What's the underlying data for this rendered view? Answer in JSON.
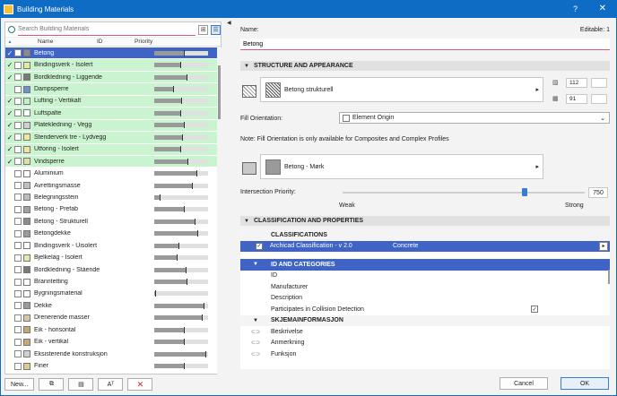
{
  "window": {
    "title": "Building Materials",
    "help_label": "?",
    "close_label": "✕"
  },
  "left": {
    "search_placeholder": "Search Building Materials",
    "columns": {
      "name": "Name",
      "id": "ID",
      "priority": "Priority",
      "sort": "▲"
    },
    "items": [
      {
        "name": "Betong",
        "checked": true,
        "green": false,
        "selected": true,
        "color": "#8c8c8c",
        "priority": 55
      },
      {
        "name": "Bindingsverk - Isolert",
        "checked": true,
        "green": true,
        "selected": false,
        "color": "#e8e8a0",
        "priority": 48
      },
      {
        "name": "Bordkledning - Liggende",
        "checked": true,
        "green": true,
        "selected": false,
        "color": "#7a7a7a",
        "priority": 60
      },
      {
        "name": "Dampsperre",
        "checked": false,
        "green": true,
        "selected": false,
        "color": "#6f8fd8",
        "priority": 35
      },
      {
        "name": "Lufting - Vertikalt",
        "checked": true,
        "green": true,
        "selected": false,
        "color": "#c8f0c8",
        "priority": 50
      },
      {
        "name": "Luftspalte",
        "checked": true,
        "green": true,
        "selected": false,
        "color": "#ffffff",
        "priority": 48
      },
      {
        "name": "Platekledning - Vegg",
        "checked": true,
        "green": true,
        "selected": false,
        "color": "#d0d0d0",
        "priority": 55
      },
      {
        "name": "Stenderverk tre - Lydvegg",
        "checked": true,
        "green": true,
        "selected": false,
        "color": "#f0e6a0",
        "priority": 52
      },
      {
        "name": "Utforing - Isolert",
        "checked": true,
        "green": true,
        "selected": false,
        "color": "#f0e6a0",
        "priority": 48
      },
      {
        "name": "Vindsperre",
        "checked": true,
        "green": true,
        "selected": false,
        "color": "#e0e0a0",
        "priority": 62
      },
      {
        "name": "Aluminium",
        "checked": false,
        "green": false,
        "selected": false,
        "color": "#ffffff",
        "priority": 78
      },
      {
        "name": "Avrettingsmasse",
        "checked": false,
        "green": false,
        "selected": false,
        "color": "#c0c0c0",
        "priority": 70
      },
      {
        "name": "Belegningsstein",
        "checked": false,
        "green": false,
        "selected": false,
        "color": "#bdbdbd",
        "priority": 10
      },
      {
        "name": "Betong - Prefab",
        "checked": false,
        "green": false,
        "selected": false,
        "color": "#a0a0a0",
        "priority": 55
      },
      {
        "name": "Betong - Strukturell",
        "checked": false,
        "green": false,
        "selected": false,
        "color": "#8c8c8c",
        "priority": 75
      },
      {
        "name": "Betongdekke",
        "checked": false,
        "green": false,
        "selected": false,
        "color": "#9a9a9a",
        "priority": 80
      },
      {
        "name": "Bindingsverk - Uisolert",
        "checked": false,
        "green": false,
        "selected": false,
        "color": "#ffffff",
        "priority": 45
      },
      {
        "name": "Bjelkelag - Isolert",
        "checked": false,
        "green": false,
        "selected": false,
        "color": "#e8e8a0",
        "priority": 42
      },
      {
        "name": "Bordkledning - Stående",
        "checked": false,
        "green": false,
        "selected": false,
        "color": "#7a7a7a",
        "priority": 58
      },
      {
        "name": "Branntetting",
        "checked": false,
        "green": false,
        "selected": false,
        "color": "#ffffff",
        "priority": 60
      },
      {
        "name": "Bygningsmaterial",
        "checked": false,
        "green": false,
        "selected": false,
        "color": "#ffffff",
        "priority": 2
      },
      {
        "name": "Dekke",
        "checked": false,
        "green": false,
        "selected": false,
        "color": "#9a9a9a",
        "priority": 92
      },
      {
        "name": "Drenerende masser",
        "checked": false,
        "green": false,
        "selected": false,
        "color": "#d8c8a8",
        "priority": 88
      },
      {
        "name": "Eik - horisontal",
        "checked": false,
        "green": false,
        "selected": false,
        "color": "#c8a870",
        "priority": 55
      },
      {
        "name": "Eik - vertikal",
        "checked": false,
        "green": false,
        "selected": false,
        "color": "#c8a870",
        "priority": 55
      },
      {
        "name": "Eksisterende konstruksjon",
        "checked": false,
        "green": false,
        "selected": false,
        "color": "#d0d0d0",
        "priority": 95
      },
      {
        "name": "Finer",
        "checked": false,
        "green": false,
        "selected": false,
        "color": "#e0c890",
        "priority": 55
      }
    ],
    "buttons": {
      "new": "New...",
      "rename_icon": "Aᵀ",
      "delete_icon": "✕"
    }
  },
  "right": {
    "name_label": "Name:",
    "editable": "Editable: 1",
    "name_value": "Betong",
    "structure": {
      "title": "STRUCTURE AND APPEARANCE",
      "cut_fill": "Betong strukturell",
      "pen1": "112",
      "pen2": "91",
      "fill_orientation_label": "Fill Orientation:",
      "fill_orientation_value": "Element Origin",
      "note": "Note: Fill Orientation is only available for Composites and Complex Profiles",
      "surface": "Betong - Mørk",
      "intersection_label": "Intersection Priority:",
      "intersection_value": "750",
      "intersection_fraction": 0.75,
      "weak": "Weak",
      "strong": "Strong"
    },
    "classification": {
      "title": "CLASSIFICATION AND PROPERTIES",
      "classifications_header": "CLASSIFICATIONS",
      "class_row_name": "Archicad Classification - v 2.0",
      "class_row_value": "Concrete",
      "id_categories_header": "ID AND CATEGORIES",
      "id_rows": [
        "ID",
        "Manufacturer",
        "Description",
        "Participates in Collision Detection"
      ],
      "collision_checked": "✓",
      "schema_header": "SKJEMAINFORMASJON",
      "schema_rows": [
        "Beskrivelse",
        "Anmerkning",
        "Funksjon"
      ]
    },
    "buttons": {
      "cancel": "Cancel",
      "ok": "OK"
    }
  }
}
